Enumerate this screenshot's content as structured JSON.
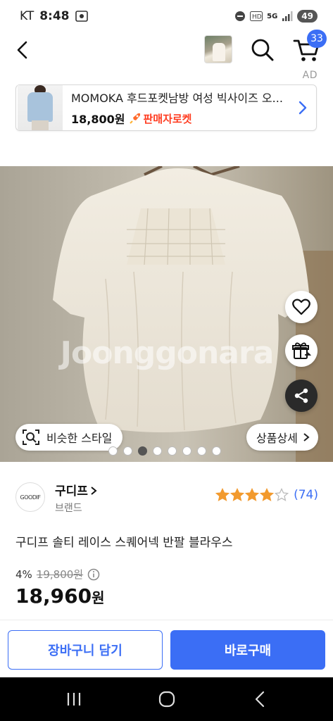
{
  "status_bar": {
    "carrier": "KT",
    "time": "8:48",
    "network": "5G",
    "battery": "49"
  },
  "top_nav": {
    "cart_count": "33"
  },
  "ad": {
    "label": "AD",
    "title": "MOMOKA 후드포켓남방 여성 빅사이즈 오...",
    "price": "18,800원",
    "badge": "판매자로켓"
  },
  "gallery": {
    "watermark": "Joonggonara",
    "similar_style_label": "비슷한 스타일",
    "detail_label": "상품상세",
    "dot_count": 8,
    "active_dot": 2
  },
  "brand": {
    "name": "구디프",
    "sub": "브랜드",
    "logo_text": "GOODIF"
  },
  "rating": {
    "stars": 4,
    "review_count": "(74)"
  },
  "product": {
    "title": "구디프 솔티 레이스 스퀘어넥 반팔 블라우스"
  },
  "price": {
    "discount": "4%",
    "original": "19,800원",
    "final": "18,960",
    "currency": "원"
  },
  "actions": {
    "add_to_cart": "장바구니 담기",
    "buy_now": "바로구매"
  },
  "colors": {
    "accent": "#3b6ef5",
    "rocket": "#ff3b1f",
    "star": "#f29a2e"
  },
  "icons": [
    "back-icon",
    "search-icon",
    "cart-icon",
    "chevron-right-icon",
    "heart-icon",
    "gift-icon",
    "share-icon",
    "scan-icon",
    "info-icon",
    "star-icon",
    "nav-recent-icon",
    "nav-home-icon",
    "nav-back-icon"
  ]
}
